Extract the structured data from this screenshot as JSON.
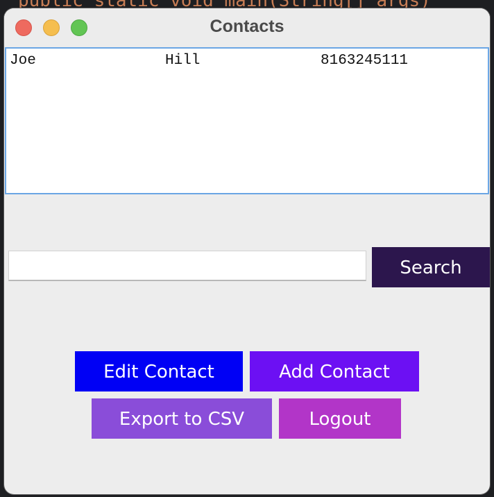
{
  "background": {
    "code_fragment": "public static void main(String[] args)"
  },
  "window": {
    "title": "Contacts",
    "controls": {
      "close_color": "#ee6a5f",
      "minimize_color": "#f5be4f",
      "maximize_color": "#62c554"
    }
  },
  "contacts": {
    "rows": [
      {
        "first": "Joe",
        "last": "Hill",
        "phone": "8163245111"
      }
    ]
  },
  "search": {
    "value": "",
    "placeholder": "",
    "button_label": "Search"
  },
  "actions": {
    "edit_label": "Edit Contact",
    "add_label": "Add Contact",
    "export_label": "Export to CSV",
    "logout_label": "Logout"
  },
  "colors": {
    "search_button": "#2c164d",
    "edit_button": "#0000f5",
    "add_button": "#6c10f3",
    "export_button": "#8a4dd9",
    "logout_button": "#b235c8",
    "list_border": "#6aa5e4"
  }
}
